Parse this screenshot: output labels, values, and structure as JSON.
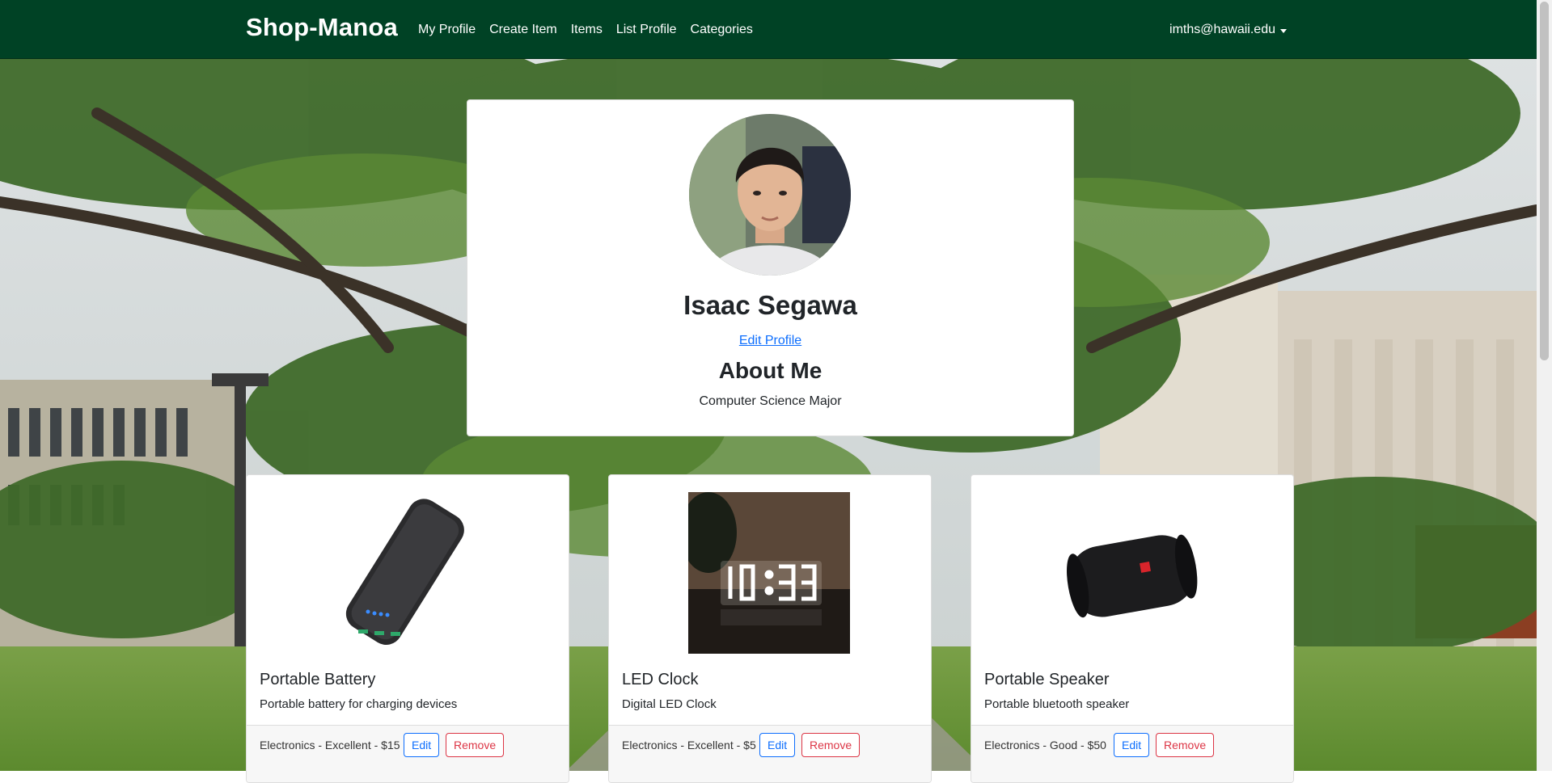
{
  "navbar": {
    "brand": "Shop-Manoa",
    "links": [
      "My Profile",
      "Create Item",
      "Items",
      "List Profile",
      "Categories"
    ],
    "user": "imths@hawaii.edu"
  },
  "profile": {
    "name": "Isaac Segawa",
    "edit_label": "Edit Profile",
    "about_heading": "About Me",
    "about_text": "Computer Science Major"
  },
  "items": [
    {
      "title": "Portable Battery",
      "description": "Portable battery for charging devices",
      "meta": "Electronics - Excellent - $15",
      "edit_label": "Edit",
      "remove_label": "Remove",
      "image": "portable-battery-image"
    },
    {
      "title": "LED Clock",
      "description": "Digital LED Clock",
      "meta": "Electronics - Excellent - $5",
      "edit_label": "Edit",
      "remove_label": "Remove",
      "image": "led-clock-image"
    },
    {
      "title": "Portable Speaker",
      "description": "Portable bluetooth speaker",
      "meta": "Electronics - Good - $50",
      "edit_label": "Edit",
      "remove_label": "Remove",
      "image": "bluetooth-speaker-image"
    }
  ],
  "colors": {
    "navbar": "#004225",
    "link": "#0d6efd",
    "danger": "#dc3545"
  }
}
